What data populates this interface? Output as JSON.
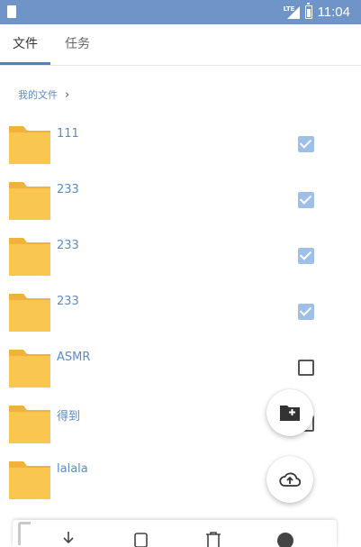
{
  "status_bar": {
    "time": "11:04",
    "network": "LTE",
    "icons": [
      "sim-card-icon",
      "lte-signal-icon",
      "battery-icon"
    ]
  },
  "tabs": [
    {
      "label": "文件",
      "active": true
    },
    {
      "label": "任务",
      "active": false
    }
  ],
  "breadcrumb": {
    "label": "我的文件",
    "chevron": "›"
  },
  "files": [
    {
      "name": "111",
      "checked": true
    },
    {
      "name": "233",
      "checked": true
    },
    {
      "name": "233",
      "checked": true
    },
    {
      "name": "233",
      "checked": true
    },
    {
      "name": "ASMR",
      "checked": false
    },
    {
      "name": "得到",
      "checked": false
    },
    {
      "name": "lalala",
      "checked": false
    }
  ],
  "fabs": {
    "new_folder_icon": "new-folder-icon",
    "upload_icon": "cloud-upload-icon"
  },
  "bottom_toolbar": {
    "icons": [
      "download-icon",
      "copy-icon",
      "delete-icon",
      "more-icon"
    ]
  },
  "colors": {
    "status_bar": "#6f95c8",
    "accent": "#4f7fc0",
    "link_text": "#5b8bc7",
    "folder": "#f9c74f",
    "folder_shadow": "#f0b23a",
    "checkbox_checked": "#9ebfe7"
  }
}
